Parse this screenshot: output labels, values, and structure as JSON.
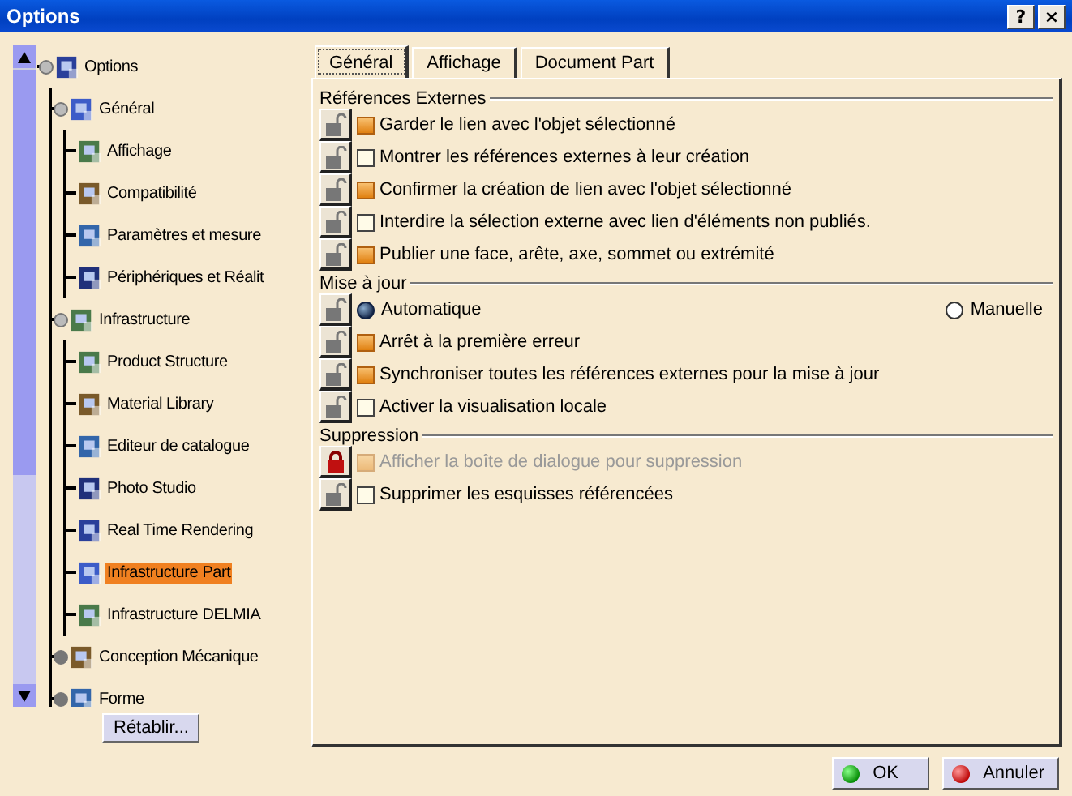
{
  "window": {
    "title": "Options",
    "help": "?",
    "close": "×"
  },
  "tree": [
    {
      "label": "Options",
      "expanded": true,
      "selected": false,
      "children": [
        {
          "label": "Général",
          "expanded": true,
          "selected": false,
          "children": [
            {
              "label": "Affichage",
              "selected": false
            },
            {
              "label": "Compatibilité",
              "selected": false
            },
            {
              "label": "Paramètres et mesure",
              "selected": false
            },
            {
              "label": "Périphériques et Réalit",
              "selected": false
            }
          ]
        },
        {
          "label": "Infrastructure",
          "expanded": true,
          "selected": false,
          "children": [
            {
              "label": "Product Structure",
              "selected": false
            },
            {
              "label": "Material Library",
              "selected": false
            },
            {
              "label": "Editeur de catalogue",
              "selected": false
            },
            {
              "label": "Photo Studio",
              "selected": false
            },
            {
              "label": "Real Time Rendering",
              "selected": false
            },
            {
              "label": "Infrastructure Part",
              "selected": true
            },
            {
              "label": "Infrastructure DELMIA",
              "selected": false
            }
          ]
        },
        {
          "label": "Conception Mécanique",
          "expanded": false,
          "selected": false
        },
        {
          "label": "Forme",
          "expanded": false,
          "selected": false
        }
      ]
    }
  ],
  "reset_button": "Rétablir...",
  "tabs": [
    {
      "label": "Général",
      "selected": true
    },
    {
      "label": "Affichage",
      "selected": false
    },
    {
      "label": "Document Part",
      "selected": false
    }
  ],
  "sections": [
    {
      "title": "Références Externes",
      "rows": [
        {
          "kind": "checkbox",
          "label": "Garder le lien avec l'objet sélectionné",
          "checked": true,
          "locked": false,
          "disabled": false
        },
        {
          "kind": "checkbox",
          "label": "Montrer les références externes à leur création",
          "checked": false,
          "locked": false,
          "disabled": false
        },
        {
          "kind": "checkbox",
          "label": "Confirmer la création de lien avec l'objet sélectionné",
          "checked": true,
          "locked": false,
          "disabled": false
        },
        {
          "kind": "checkbox",
          "label": "Interdire la sélection externe avec lien d'éléments non publiés.",
          "checked": false,
          "locked": false,
          "disabled": false
        },
        {
          "kind": "checkbox",
          "label": "Publier une face, arête, axe, sommet ou extrémité",
          "checked": true,
          "locked": false,
          "disabled": false
        }
      ]
    },
    {
      "title": "Mise à jour",
      "rows": [
        {
          "kind": "radio",
          "locked": false,
          "options": [
            {
              "label": "Automatique",
              "selected": true
            },
            {
              "label": "Manuelle",
              "selected": false
            }
          ]
        },
        {
          "kind": "checkbox",
          "label": "Arrêt à la première erreur",
          "checked": true,
          "locked": false,
          "disabled": false
        },
        {
          "kind": "checkbox",
          "label": "Synchroniser toutes les références externes pour la mise à jour",
          "checked": true,
          "locked": false,
          "disabled": false
        },
        {
          "kind": "checkbox",
          "label": "Activer la visualisation locale",
          "checked": false,
          "locked": false,
          "disabled": false
        }
      ]
    },
    {
      "title": "Suppression",
      "rows": [
        {
          "kind": "checkbox",
          "label": "Afficher la boîte de dialogue pour suppression",
          "checked": true,
          "locked": true,
          "disabled": true
        },
        {
          "kind": "checkbox",
          "label": "Supprimer les esquisses référencées",
          "checked": false,
          "locked": false,
          "disabled": false
        }
      ]
    }
  ],
  "buttons": [
    {
      "label": "OK",
      "kind": "ok"
    },
    {
      "label": "Annuler",
      "kind": "cancel"
    }
  ]
}
